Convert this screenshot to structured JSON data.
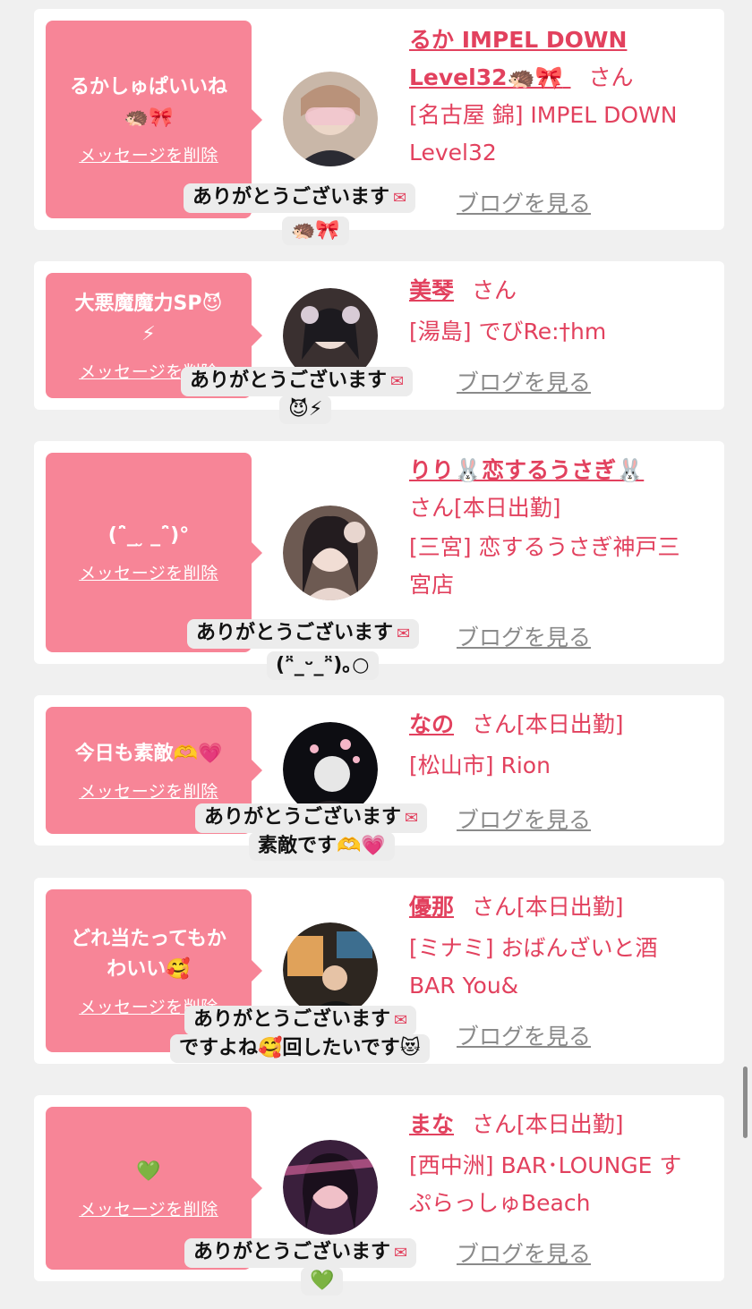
{
  "messages": [
    {
      "message_lines": [
        "るかしゅぱいいね",
        "🦔🎀"
      ],
      "delete_label": "メッセージを削除",
      "name": "るか IMPEL DOWN Level32🦔🎀",
      "name_lines": [
        "るか IMPEL DOWN",
        "Level32🦔🎀"
      ],
      "honorific": "さん",
      "shop_lines": [
        "[名古屋 錦] IMPEL DOWN",
        "Level32"
      ],
      "blog_label": "ブログを見る",
      "reply_lines": [
        "ありがとうございます",
        "🦔🎀"
      ],
      "avatar_colors": [
        "#c9b7a8",
        "#f2c6cf"
      ]
    },
    {
      "message_lines": [
        "大悪魔魔力SP😈",
        "⚡"
      ],
      "delete_label": "メッセージを削除",
      "name_lines": [
        "美琴"
      ],
      "honorific": "さん",
      "shop_lines": [
        "[湯島] でびRe:†hm"
      ],
      "blog_label": "ブログを見る",
      "reply_lines": [
        "ありがとうございます",
        "😈⚡"
      ],
      "avatar_colors": [
        "#3a3030",
        "#d8cbd6"
      ]
    },
    {
      "message_lines": [
        "(ˆ̈_ ̮ _ˆ̈)°"
      ],
      "delete_label": "メッセージを削除",
      "name_lines": [
        "りり🐰恋するうさぎ🐰"
      ],
      "honorific": "さん",
      "status": "[本日出勤]",
      "shop_lines": [
        "[三宮] 恋するうさぎ神戸三",
        "宮店"
      ],
      "blog_label": "ブログを見る",
      "reply_lines": [
        "ありがとうございます",
        "(ᵔ̈_ᵕ_ᵔ̈)｡○"
      ],
      "avatar_colors": [
        "#6d5a52",
        "#e8d6cf"
      ]
    },
    {
      "message_lines": [
        "今日も素敵🫶💗"
      ],
      "delete_label": "メッセージを削除",
      "name_lines": [
        "なの"
      ],
      "honorific": "さん",
      "status": "[本日出勤]",
      "shop_lines": [
        "[松山市] Rion"
      ],
      "blog_label": "ブログを見る",
      "reply_lines": [
        "ありがとうございます",
        "素敵です🫶💗"
      ],
      "avatar_colors": [
        "#0d0d12",
        "#f4b6c8"
      ]
    },
    {
      "message_lines": [
        "どれ当たってもか",
        "わいい🥰"
      ],
      "delete_label": "メッセージを削除",
      "name_lines": [
        "優那"
      ],
      "honorific": "さん",
      "status": "[本日出勤]",
      "shop_lines": [
        "[ミナミ] おばんざいと酒",
        "BAR You&"
      ],
      "blog_label": "ブログを見る",
      "reply_lines": [
        "ありがとうございます",
        "ですよね🥰回したいです😻"
      ],
      "avatar_colors": [
        "#2d2620",
        "#e0a25a"
      ]
    },
    {
      "message_lines": [
        "💚"
      ],
      "delete_label": "メッセージを削除",
      "name_lines": [
        "まな"
      ],
      "honorific": "さん",
      "status": "[本日出勤]",
      "shop_lines": [
        "[西中洲] BAR･LOUNGE す",
        "ぷらっしゅBeach"
      ],
      "blog_label": "ブログを見る",
      "reply_lines": [
        "ありがとうございます",
        "💚"
      ],
      "avatar_colors": [
        "#3a1f3c",
        "#e86aa7"
      ]
    }
  ],
  "colors": {
    "accent_pink": "#f78597",
    "link_red": "#e2415e",
    "bubble_gray": "#ececec",
    "page_bg": "#f0f0f0"
  },
  "icons": {
    "reply_marker": "envelope-heart-icon"
  }
}
